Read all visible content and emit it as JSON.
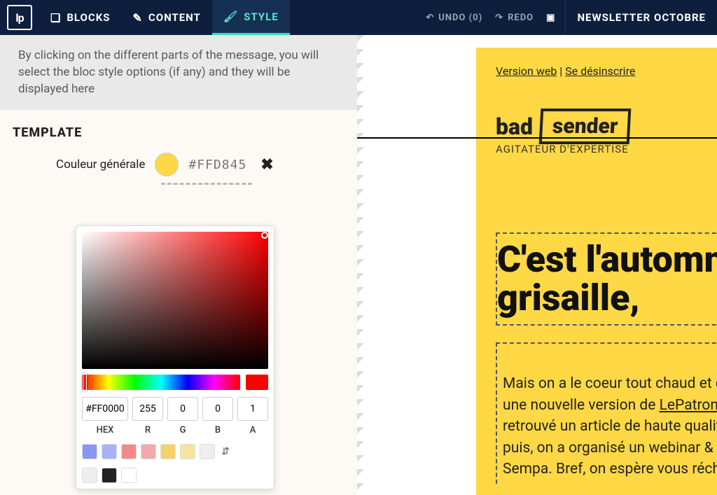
{
  "topbar": {
    "logo": "lp",
    "tabs": [
      {
        "label": "BLOCKS",
        "icon": "❑"
      },
      {
        "label": "CONTENT",
        "icon": "✎"
      },
      {
        "label": "STYLE",
        "icon": "🖌"
      }
    ],
    "undo": "UNDO (0)",
    "redo": "REDO",
    "doc_title": "NEWSLETTER OCTOBRE"
  },
  "hint": "By clicking on the different parts of the message, you will select the bloc style options (if any) and they will be displayed here",
  "section_title": "TEMPLATE",
  "prop": {
    "label": "Couleur générale",
    "hex": "#FFD845"
  },
  "picker": {
    "hex": "#FF0000",
    "r": "255",
    "g": "0",
    "b": "0",
    "a": "1",
    "labels": {
      "hex": "HEX",
      "r": "R",
      "g": "G",
      "b": "B",
      "a": "A"
    },
    "presets": [
      "#8a96f2",
      "#a9b2f6",
      "#f28a8a",
      "#f2a9a9",
      "#f2d36b",
      "#f5e3a0",
      "#eeeeee",
      "#222222",
      "#ffffff"
    ]
  },
  "email": {
    "web": "Version web",
    "unsub": "Se désinscrire",
    "brand_left": "bad",
    "brand_right": "sender",
    "tagline": "AGITATEUR D'EXPERTISE",
    "headline": "C'est l'automne, la grisaille,",
    "body_parts": {
      "p1": "Mais on a le coeur tout chaud et on vient de sortir une nouvelle version de ",
      "link": "LePatron",
      "p2": " 😅.. Thom a retrouvé un article de haute qualité sur le sujet. Et puis, on a organisé un webinar & été interviewé par Sempa. Bref, on espère vous réchauffer"
    }
  }
}
